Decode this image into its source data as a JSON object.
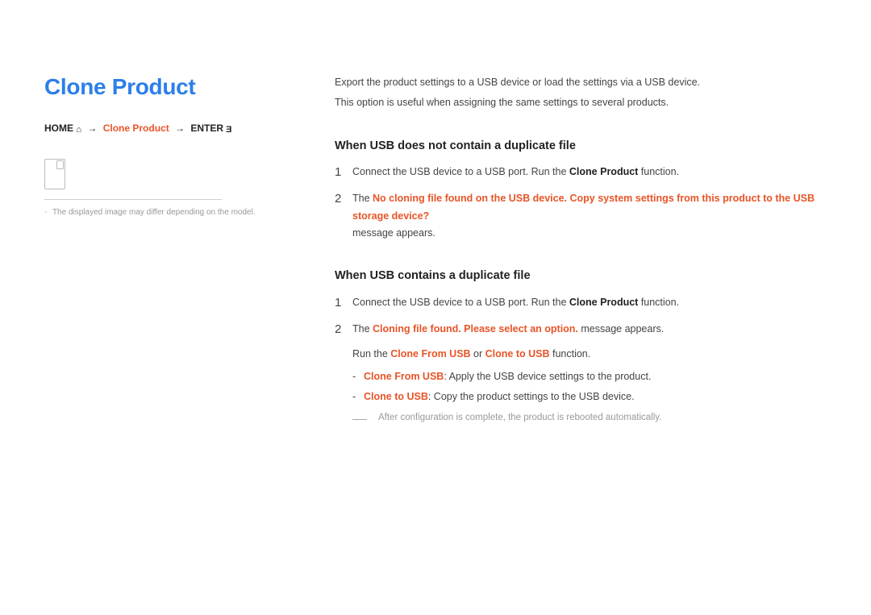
{
  "left": {
    "title": "Clone Product",
    "breadcrumb": {
      "home": "HOME",
      "arrow": "→",
      "item": "Clone Product",
      "enter": "ENTER"
    },
    "footnote": "The displayed image may differ depending on the model."
  },
  "right": {
    "intro_line1": "Export the product settings to a USB device or load the settings via a USB device.",
    "intro_line2": "This option is useful when assigning the same settings to several products.",
    "section1": {
      "heading": "When USB does not contain a duplicate file",
      "steps": [
        {
          "n": "1",
          "pre": "Connect the USB device to a USB port. Run the ",
          "bold": "Clone Product",
          "post": " function."
        },
        {
          "n": "2",
          "pre": "The ",
          "em": "No cloning file found on the USB device. Copy system settings from this product to the USB storage device?",
          "post_break": "message appears."
        }
      ]
    },
    "section2": {
      "heading": "When USB contains a duplicate file",
      "step1": {
        "n": "1",
        "pre": "Connect the USB device to a USB port. Run the ",
        "bold": "Clone Product",
        "post": " function."
      },
      "step2": {
        "n": "2",
        "line1_pre": "The ",
        "line1_em": "Cloning file found. Please select an option.",
        "line1_post": " message appears.",
        "line2_pre": "Run the ",
        "line2_em1": "Clone From USB",
        "line2_mid": " or ",
        "line2_em2": "Clone to USB",
        "line2_post": " function.",
        "opt1_label": "Clone From USB",
        "opt1_text": ": Apply the USB device settings to the product.",
        "opt2_label": "Clone to USB",
        "opt2_text": ": Copy the product settings to the USB device.",
        "note": "After configuration is complete, the product is rebooted automatically."
      }
    }
  }
}
